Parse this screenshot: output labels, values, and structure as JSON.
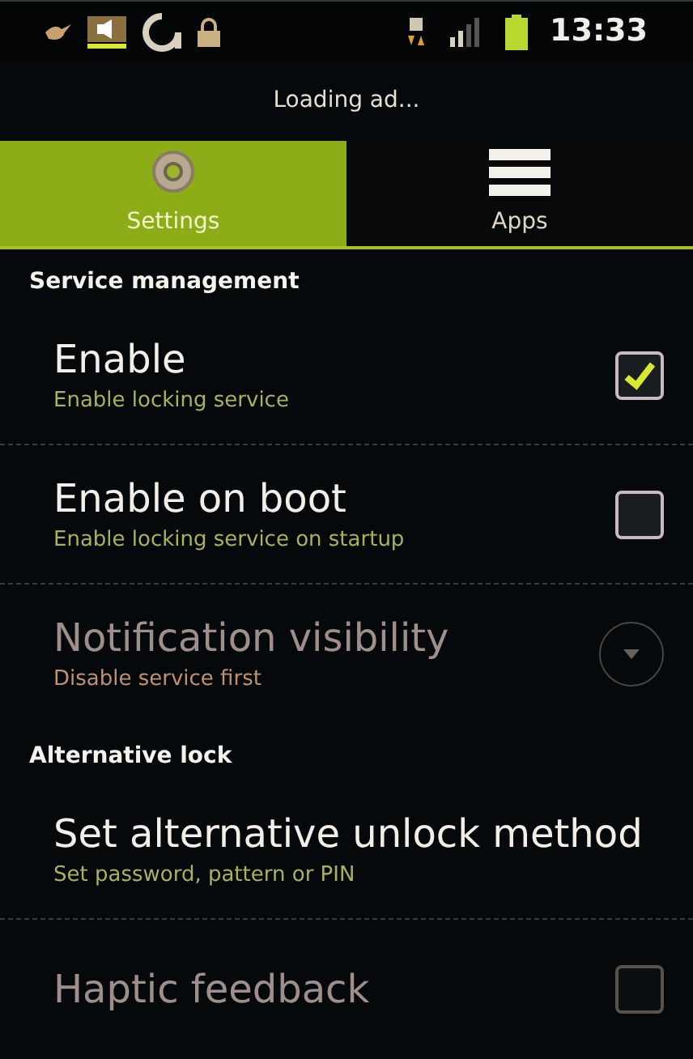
{
  "status_bar": {
    "time": "13:33"
  },
  "ad_banner": {
    "text": "Loading ad..."
  },
  "tabs": [
    {
      "label": "Settings",
      "kind": "gear",
      "selected": true
    },
    {
      "label": "Apps",
      "kind": "list",
      "selected": false
    }
  ],
  "sections": [
    {
      "title": "Service management",
      "items": [
        {
          "kind": "checkbox",
          "title": "Enable",
          "summary": "Enable locking service",
          "checked": true,
          "disabled": false
        },
        {
          "kind": "checkbox",
          "title": "Enable on boot",
          "summary": "Enable locking service on startup",
          "checked": false,
          "disabled": false
        },
        {
          "kind": "dropdown",
          "title": "Notification visibility",
          "summary": "Disable service first",
          "disabled": true
        }
      ]
    },
    {
      "title": "Alternative lock",
      "items": [
        {
          "kind": "plain",
          "title": "Set alternative unlock method",
          "summary": "Set password, pattern or PIN",
          "disabled": false
        },
        {
          "kind": "checkbox",
          "title": "Haptic feedback",
          "checked": false,
          "disabled": true
        }
      ]
    }
  ]
}
